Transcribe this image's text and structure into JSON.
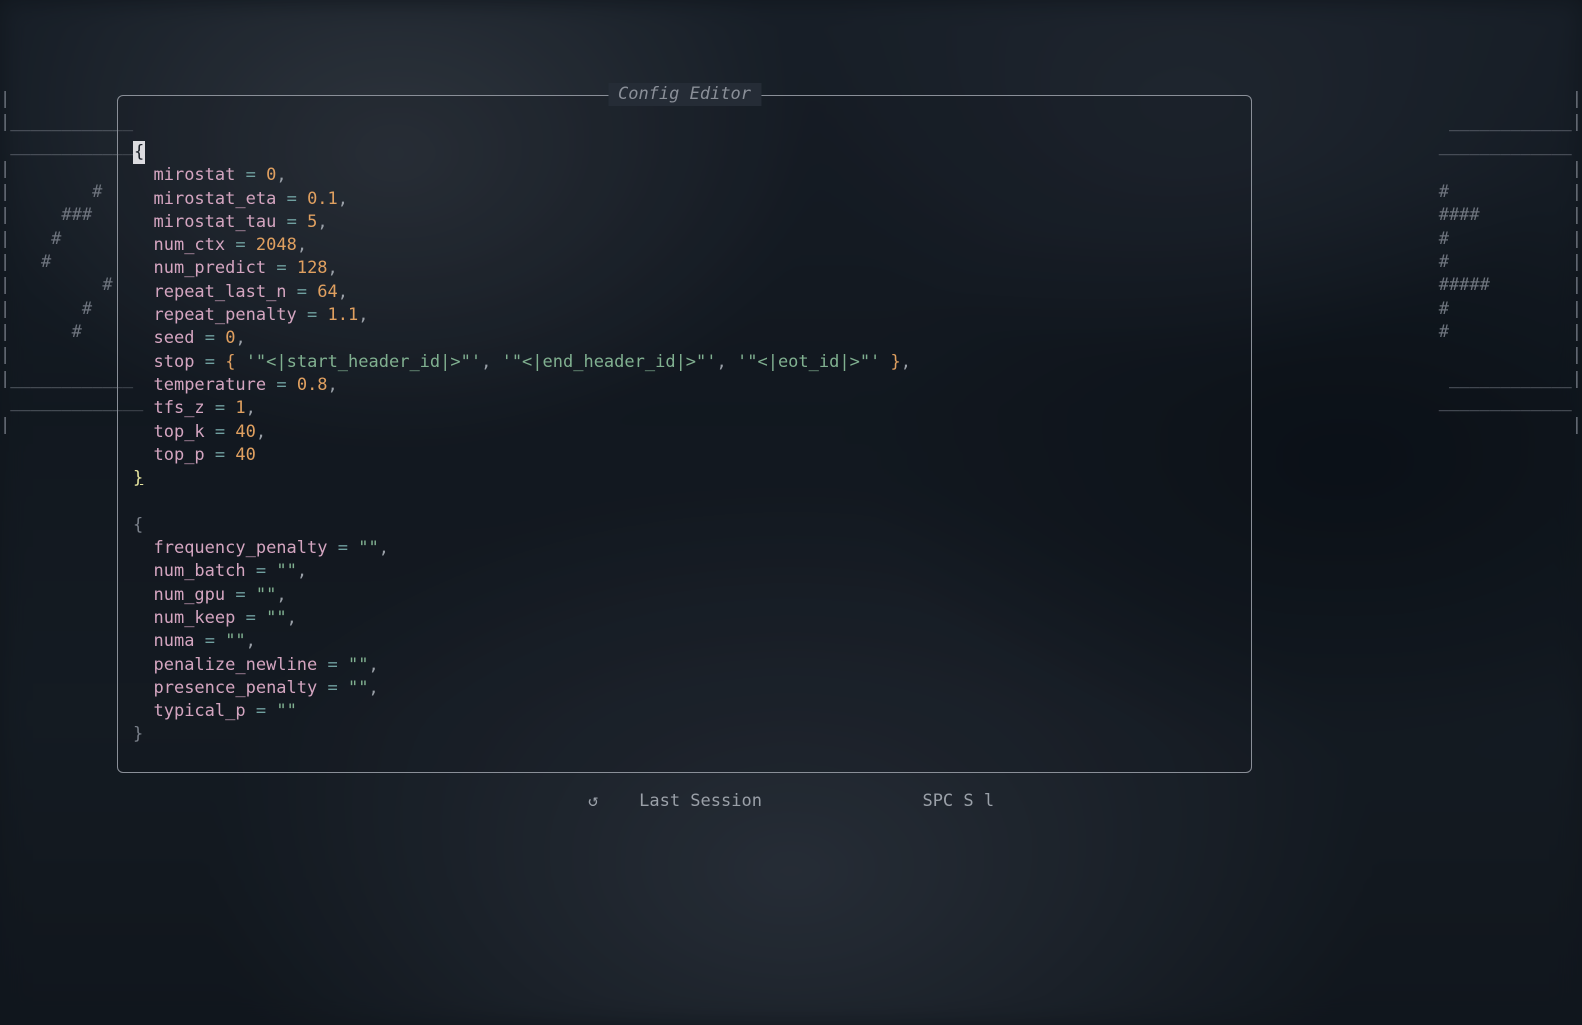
{
  "panel": {
    "title": "Config Editor"
  },
  "block1": {
    "open": "{",
    "close": "}",
    "params": [
      {
        "key": "mirostat",
        "value": "0",
        "kind": "num",
        "comma": true
      },
      {
        "key": "mirostat_eta",
        "value": "0.1",
        "kind": "num",
        "comma": true
      },
      {
        "key": "mirostat_tau",
        "value": "5",
        "kind": "num",
        "comma": true
      },
      {
        "key": "num_ctx",
        "value": "2048",
        "kind": "num",
        "comma": true
      },
      {
        "key": "num_predict",
        "value": "128",
        "kind": "num",
        "comma": true
      },
      {
        "key": "repeat_last_n",
        "value": "64",
        "kind": "num",
        "comma": true
      },
      {
        "key": "repeat_penalty",
        "value": "1.1",
        "kind": "num",
        "comma": true
      },
      {
        "key": "seed",
        "value": "0",
        "kind": "num",
        "comma": true
      }
    ],
    "stop_line": {
      "key": "stop",
      "items": [
        "'\"<|start_header_id|>\"'",
        "'\"<|end_header_id|>\"'",
        "'\"<|eot_id|>\"'"
      ],
      "comma": true
    },
    "tail": [
      {
        "key": "temperature",
        "value": "0.8",
        "kind": "num",
        "comma": true
      },
      {
        "key": "tfs_z",
        "value": "1",
        "kind": "num",
        "comma": true
      },
      {
        "key": "top_k",
        "value": "40",
        "kind": "num",
        "comma": true
      },
      {
        "key": "top_p",
        "value": "40",
        "kind": "num",
        "comma": false
      }
    ]
  },
  "block2": {
    "open": "{",
    "close": "}",
    "params": [
      {
        "key": "frequency_penalty",
        "value": "\"\"",
        "kind": "str",
        "comma": true
      },
      {
        "key": "num_batch",
        "value": "\"\"",
        "kind": "str",
        "comma": true
      },
      {
        "key": "num_gpu",
        "value": "\"\"",
        "kind": "str",
        "comma": true
      },
      {
        "key": "num_keep",
        "value": "\"\"",
        "kind": "str",
        "comma": true
      },
      {
        "key": "numa",
        "value": "\"\"",
        "kind": "str",
        "comma": true
      },
      {
        "key": "penalize_newline",
        "value": "\"\"",
        "kind": "str",
        "comma": true
      },
      {
        "key": "presence_penalty",
        "value": "\"\"",
        "kind": "str",
        "comma": true
      },
      {
        "key": "typical_p",
        "value": "\"\"",
        "kind": "str",
        "comma": false
      }
    ]
  },
  "statusbar": {
    "reload_glyph": "↻",
    "last_session": "Last Session",
    "shortcut": "SPC S l"
  },
  "bg_art": {
    "left": "|\n|____________\n _____________\n|\n|        #\n|     ###\n|    #\n|   #\n|         #\n|       #\n|      #\n|\n|____________\n _____________\n|",
    "right": "|\n____________|\n_____________ \n|\n#            |\n####         |\n#            |\n#            |\n#####        |\n#            |\n#            |\n|\n____________|\n_____________ \n|"
  }
}
